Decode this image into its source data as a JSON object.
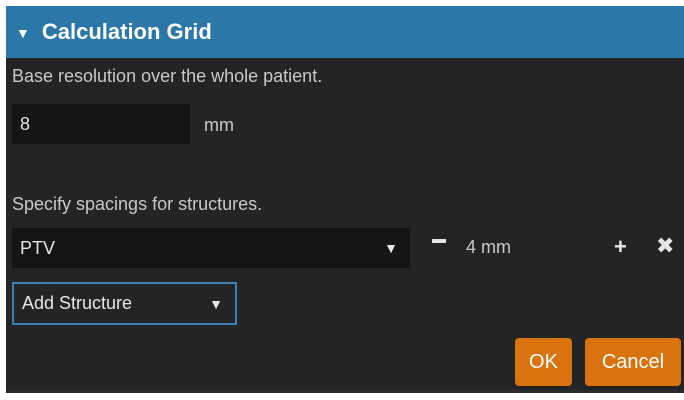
{
  "panel": {
    "title": "Calculation Grid",
    "collapse_icon": "▼"
  },
  "base": {
    "label": "Base resolution over the whole patient.",
    "value": "8",
    "unit": "mm"
  },
  "structures": {
    "label": "Specify spacings for structures.",
    "rows": [
      {
        "structure": "PTV",
        "spacing": "4 mm"
      }
    ],
    "add_label": "Add Structure"
  },
  "buttons": {
    "ok": "OK",
    "cancel": "Cancel"
  },
  "icons": {
    "dropdown": "chevron-down-icon",
    "minus": "minus-icon",
    "plus": "plus-icon",
    "remove": "close-icon"
  },
  "colors": {
    "header": "#2b77a8",
    "accent_button": "#d9730f",
    "panel_bg": "#232425",
    "input_bg": "#141516",
    "focus_border": "#3d7fb3"
  }
}
